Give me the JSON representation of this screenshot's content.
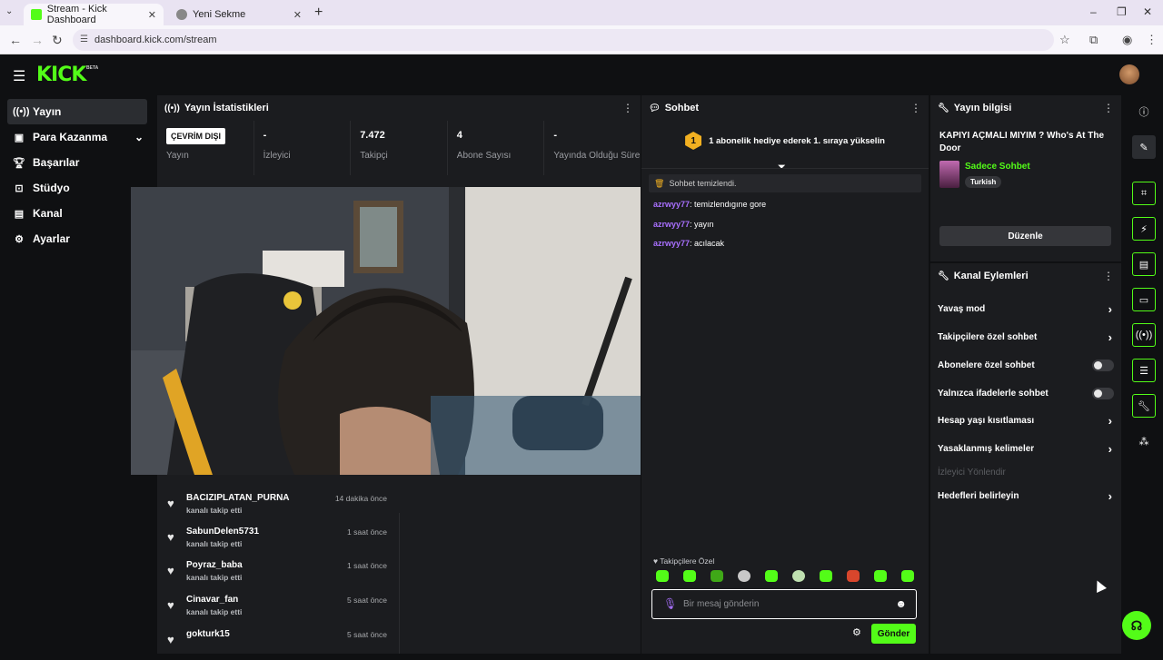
{
  "browser": {
    "tabs": [
      {
        "title": "Stream - Kick Dashboard",
        "active": true
      },
      {
        "title": "Yeni Sekme",
        "active": false
      }
    ],
    "url": "dashboard.kick.com/stream"
  },
  "app": {
    "logo": "KICK",
    "logo_badge": "BETA",
    "brand_color": "#53fc18"
  },
  "sidebar": {
    "items": [
      {
        "label": "Yayın",
        "icon": "broadcast-icon"
      },
      {
        "label": "Para Kazanma",
        "icon": "money-icon"
      },
      {
        "label": "Başarılar",
        "icon": "trophy-icon"
      },
      {
        "label": "Stüdyo",
        "icon": "studio-icon"
      },
      {
        "label": "Kanal",
        "icon": "channel-icon"
      },
      {
        "label": "Ayarlar",
        "icon": "gear-icon"
      }
    ]
  },
  "stats": {
    "title": "Yayın İstatistikleri",
    "status_badge": "ÇEVRİM DIŞI",
    "cells": [
      {
        "value": "",
        "label": "Yayın"
      },
      {
        "value": "-",
        "label": "İzleyici"
      },
      {
        "value": "7.472",
        "label": "Takipçi"
      },
      {
        "value": "4",
        "label": "Abone Sayısı"
      },
      {
        "value": "-",
        "label": "Yayında Olduğu Süre"
      }
    ]
  },
  "followers": [
    {
      "name": "BACIZIPLATAN_PURNA",
      "action": "kanalı takip etti",
      "time": "14 dakika önce"
    },
    {
      "name": "SabunDelen5731",
      "action": "kanalı takip etti",
      "time": "1 saat önce"
    },
    {
      "name": "Poyraz_baba",
      "action": "kanalı takip etti",
      "time": "1 saat önce"
    },
    {
      "name": "Cinavar_fan",
      "action": "kanalı takip etti",
      "time": "5 saat önce"
    },
    {
      "name": "gokturk15",
      "action": "",
      "time": "5 saat önce"
    }
  ],
  "chat": {
    "title": "Sohbet",
    "banner_rank": "1",
    "banner_text": "1 abonelik hediye ederek 1. sıraya yükselin",
    "system_message": "Sohbet temizlendi.",
    "messages": [
      {
        "user": "azrwyy77",
        "text": ": temizlendıgıne gore"
      },
      {
        "user": "azrwyy77",
        "text": ": yayın"
      },
      {
        "user": "azrwyy77",
        "text": ": acılacak"
      }
    ],
    "mode_label": "Takipçilere Özel",
    "input_placeholder": "Bir mesaj gönderin",
    "send_label": "Gönder"
  },
  "stream_info": {
    "title": "Yayın bilgisi",
    "stream_title": "KAPIYI AÇMALI MIYIM ? Who's At The Door",
    "category": "Sadece Sohbet",
    "language": "Turkish",
    "edit_label": "Düzenle"
  },
  "channel_actions": {
    "title": "Kanal Eylemleri",
    "items": [
      {
        "label": "Yavaş mod",
        "kind": "chevron"
      },
      {
        "label": "Takipçilere özel sohbet",
        "kind": "chevron"
      },
      {
        "label": "Abonelere özel sohbet",
        "kind": "toggle"
      },
      {
        "label": "Yalnızca ifadelerle sohbet",
        "kind": "toggle"
      },
      {
        "label": "Hesap yaşı kısıtlaması",
        "kind": "chevron"
      },
      {
        "label": "Yasaklanmış kelimeler",
        "kind": "chevron"
      },
      {
        "label": "İzleyici Yönlendir",
        "kind": "disabled"
      },
      {
        "label": "Hedefleri belirleyin",
        "kind": "chevron"
      }
    ]
  }
}
